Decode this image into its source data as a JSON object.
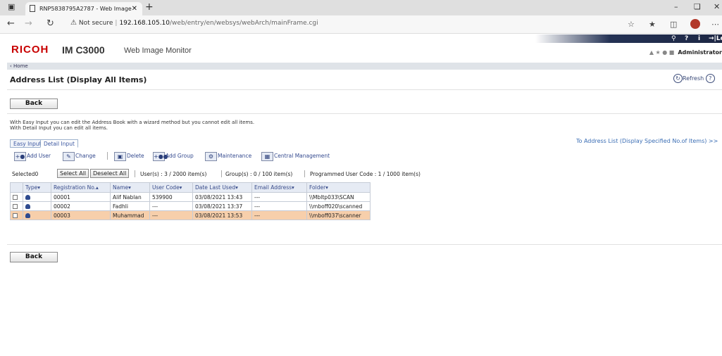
{
  "browser": {
    "tab_title": "RNP5838795A2787 - Web Image",
    "new_tab": "+",
    "not_secure": "Not secure",
    "url_host": "192.168.105.10",
    "url_path": "/web/entry/en/websys/webArch/mainFrame.cgi"
  },
  "header": {
    "brand": "RICOH",
    "model": "IM C3000",
    "product": "Web Image Monitor",
    "logout": "Logout",
    "user": "Administrator"
  },
  "home_link": "Home",
  "page_title": "Address List (Display All Items)",
  "refresh_label": "Refresh",
  "back_label": "Back",
  "description": [
    "With Easy Input you can edit the Address Book with a wizard method but you cannot edit all items.",
    "With Detail Input you can edit all items."
  ],
  "to_list_link": "To Address List (Display Specified No.of Items) >>",
  "tabs": [
    "Easy Input",
    "Detail Input"
  ],
  "toolbar": {
    "add_user": "Add User",
    "change": "Change",
    "delete": "Delete",
    "add_group": "Add Group",
    "maintenance": "Maintenance",
    "central": "Central Management"
  },
  "selection": {
    "selected": "Selected0",
    "select_all": "Select All",
    "deselect_all": "Deselect All",
    "users": "User(s) : 3 / 2000 item(s)",
    "groups": "Group(s) : 0 / 100 item(s)",
    "user_code": "Programmed User Code : 1 / 1000 item(s)"
  },
  "table": {
    "headers": [
      "Type▾",
      "Registration No.▴",
      "Name▾",
      "User Code▾",
      "Date Last Used▾",
      "Email Address▾",
      "Folder▾"
    ],
    "rows": [
      {
        "reg": "00001",
        "name": "Alif Nablan",
        "code": "539900",
        "date": "03/08/2021 13:43",
        "email": "---",
        "folder": "\\\\Mbltp033\\SCAN"
      },
      {
        "reg": "00002",
        "name": "Fadhli",
        "code": "---",
        "date": "03/08/2021 13:37",
        "email": "---",
        "folder": "\\\\mboff020\\scanned"
      },
      {
        "reg": "00003",
        "name": "Muhammad",
        "code": "---",
        "date": "03/08/2021 13:53",
        "email": "---",
        "folder": "\\\\mboff037\\scanner"
      }
    ]
  },
  "colors": {
    "brand": "#c80000",
    "highlight_row": "#f7cfab",
    "link": "#3a6db4"
  }
}
